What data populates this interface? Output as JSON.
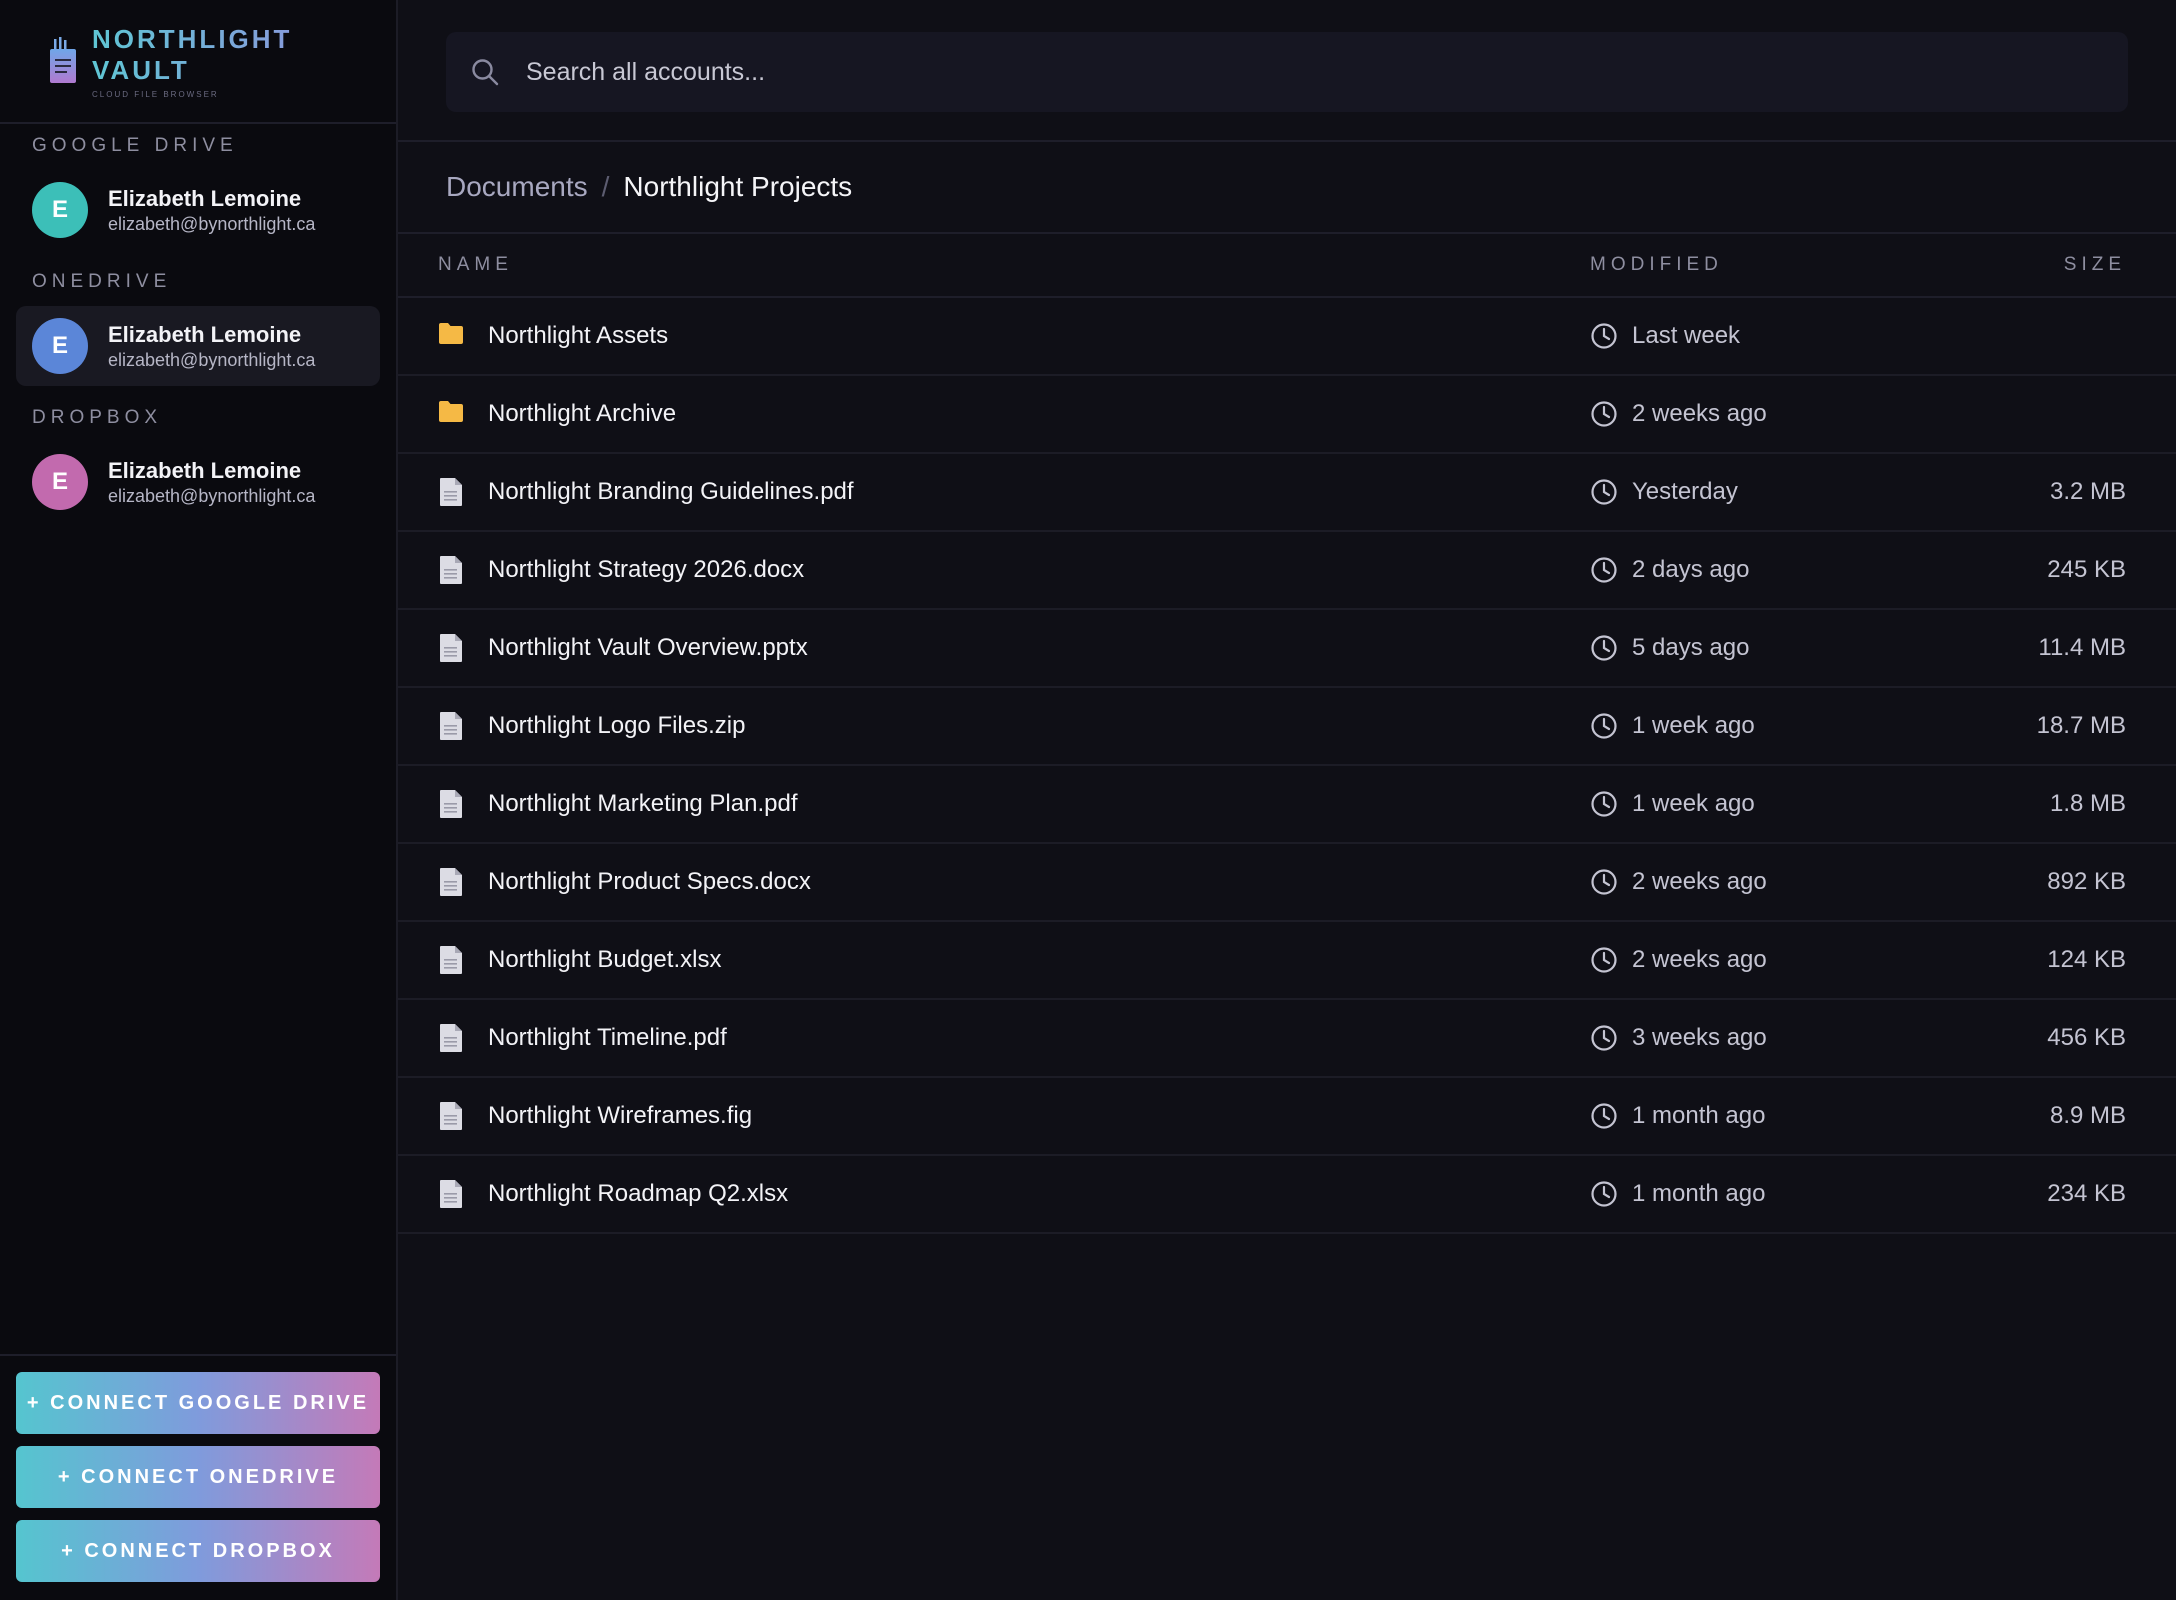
{
  "brand": {
    "name": "NORTHLIGHT VAULT",
    "subtitle": "CLOUD FILE BROWSER"
  },
  "sidebar": {
    "sections": [
      {
        "label": "GOOGLE DRIVE",
        "account": {
          "initial": "E",
          "name": "Elizabeth Lemoine",
          "email": "elizabeth@bynorthlight.ca",
          "avatar_color": "#3cbfb8",
          "active": false
        }
      },
      {
        "label": "ONEDRIVE",
        "account": {
          "initial": "E",
          "name": "Elizabeth Lemoine",
          "email": "elizabeth@bynorthlight.ca",
          "avatar_color": "#5b86d8",
          "active": true
        }
      },
      {
        "label": "DROPBOX",
        "account": {
          "initial": "E",
          "name": "Elizabeth Lemoine",
          "email": "elizabeth@bynorthlight.ca",
          "avatar_color": "#c26aae",
          "active": false
        }
      }
    ],
    "connect_buttons": [
      "+ CONNECT GOOGLE DRIVE",
      "+ CONNECT ONEDRIVE",
      "+ CONNECT DROPBOX"
    ]
  },
  "search": {
    "placeholder": "Search all accounts..."
  },
  "breadcrumb": {
    "parent": "Documents",
    "separator": "/",
    "current": "Northlight Projects"
  },
  "table": {
    "headers": {
      "name": "NAME",
      "modified": "MODIFIED",
      "size": "SIZE"
    },
    "rows": [
      {
        "type": "folder",
        "name": "Northlight Assets",
        "modified": "Last week",
        "size": ""
      },
      {
        "type": "folder",
        "name": "Northlight Archive",
        "modified": "2 weeks ago",
        "size": ""
      },
      {
        "type": "file",
        "name": "Northlight Branding Guidelines.pdf",
        "modified": "Yesterday",
        "size": "3.2 MB"
      },
      {
        "type": "file",
        "name": "Northlight Strategy 2026.docx",
        "modified": "2 days ago",
        "size": "245 KB"
      },
      {
        "type": "file",
        "name": "Northlight Vault Overview.pptx",
        "modified": "5 days ago",
        "size": "11.4 MB"
      },
      {
        "type": "file",
        "name": "Northlight Logo Files.zip",
        "modified": "1 week ago",
        "size": "18.7 MB"
      },
      {
        "type": "file",
        "name": "Northlight Marketing Plan.pdf",
        "modified": "1 week ago",
        "size": "1.8 MB"
      },
      {
        "type": "file",
        "name": "Northlight Product Specs.docx",
        "modified": "2 weeks ago",
        "size": "892 KB"
      },
      {
        "type": "file",
        "name": "Northlight Budget.xlsx",
        "modified": "2 weeks ago",
        "size": "124 KB"
      },
      {
        "type": "file",
        "name": "Northlight Timeline.pdf",
        "modified": "3 weeks ago",
        "size": "456 KB"
      },
      {
        "type": "file",
        "name": "Northlight Wireframes.fig",
        "modified": "1 month ago",
        "size": "8.9 MB"
      },
      {
        "type": "file",
        "name": "Northlight Roadmap Q2.xlsx",
        "modified": "1 month ago",
        "size": "234 KB"
      }
    ]
  },
  "icons": {
    "folder": "folder-icon",
    "file": "document-icon",
    "clock": "clock-icon",
    "search": "search-icon",
    "logo": "vault-logo-icon"
  },
  "colors": {
    "folder": "#f5b945",
    "file": "#d9d9e2",
    "accent_start": "#55c5cf",
    "accent_end": "#c47ab8"
  }
}
